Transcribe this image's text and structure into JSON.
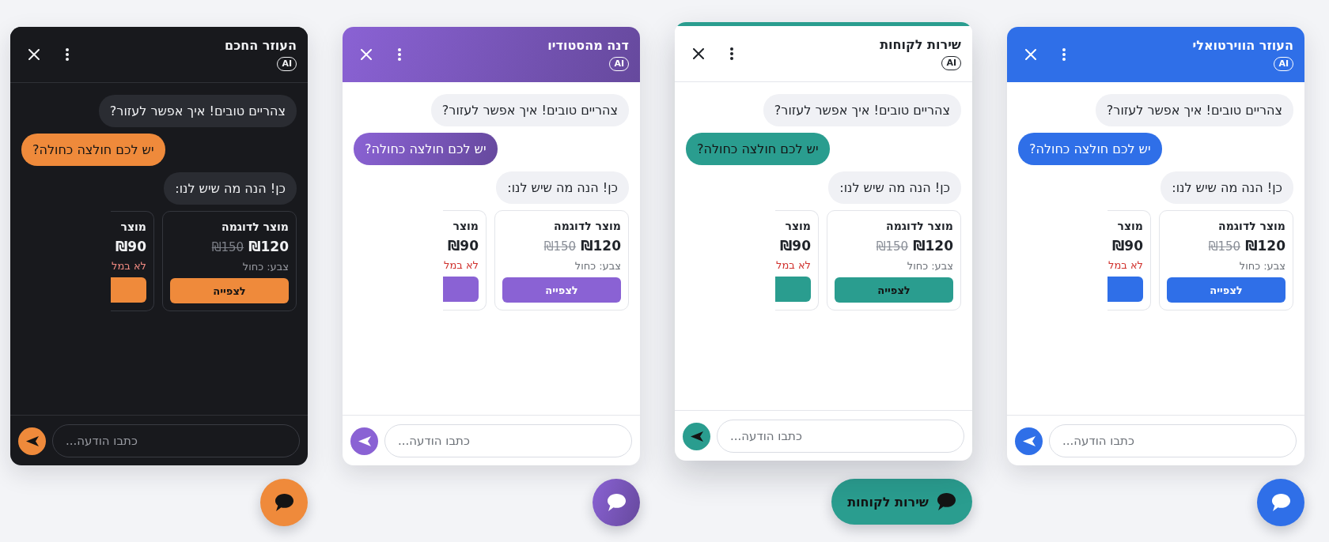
{
  "widgets": [
    {
      "dark": false,
      "color": "#2f6fe8",
      "raised": false,
      "header": {
        "kind": "solid",
        "title": "העוזר הווירטואלי",
        "badge": "AI"
      },
      "messages": [
        {
          "kind": "bot",
          "text": "צהריים טובים! איך אפשר לעזור?"
        },
        {
          "kind": "user",
          "text": "יש לכם חולצה כחולה?"
        },
        {
          "kind": "bot",
          "text": "כן! הנה מה שיש לנו:"
        }
      ],
      "products": [
        {
          "kind": "full",
          "title": "מוצר לדוגמה",
          "price": "₪120",
          "old_price": "₪150",
          "detail": "צבע: כחול",
          "button": "לצפייה"
        },
        {
          "kind": "partial",
          "title": "מוצר",
          "price": "₪90",
          "status": "לא במל"
        }
      ],
      "composer": {
        "placeholder": "כתבו הודעה..."
      },
      "launcher": {
        "kind": "icon"
      }
    },
    {
      "dark": false,
      "color": "#2a9d8f",
      "raised": true,
      "header": {
        "kind": "bar",
        "title": "שירות לקוחות",
        "badge": "AI"
      },
      "messages": [
        {
          "kind": "bot",
          "text": "צהריים טובים! איך אפשר לעזור?"
        },
        {
          "kind": "user",
          "text": "יש לכם חולצה כחולה?"
        },
        {
          "kind": "bot",
          "text": "כן! הנה מה שיש לנו:"
        }
      ],
      "products": [
        {
          "kind": "full",
          "title": "מוצר לדוגמה",
          "price": "₪120",
          "old_price": "₪150",
          "detail": "צבע: כחול",
          "button": "לצפייה"
        },
        {
          "kind": "partial",
          "title": "מוצר",
          "price": "₪90",
          "status": "לא במל"
        }
      ],
      "composer": {
        "placeholder": "כתבו הודעה..."
      },
      "launcher": {
        "kind": "pill",
        "label": "שירות לקוחות"
      }
    },
    {
      "dark": false,
      "color": "#8a62d4",
      "raised": false,
      "header": {
        "kind": "gradient",
        "title": "דנה מהסטודיו",
        "badge": "AI"
      },
      "messages": [
        {
          "kind": "bot",
          "text": "צהריים טובים! איך אפשר לעזור?"
        },
        {
          "kind": "user",
          "text": "יש לכם חולצה כחולה?"
        },
        {
          "kind": "bot",
          "text": "כן! הנה מה שיש לנו:"
        }
      ],
      "products": [
        {
          "kind": "full",
          "title": "מוצר לדוגמה",
          "price": "₪120",
          "old_price": "₪150",
          "detail": "צבע: כחול",
          "button": "לצפייה"
        },
        {
          "kind": "partial",
          "title": "מוצר",
          "price": "₪90",
          "status": "לא במל"
        }
      ],
      "composer": {
        "placeholder": "כתבו הודעה..."
      },
      "launcher": {
        "kind": "icon"
      }
    },
    {
      "dark": true,
      "color": "#ef8a3b",
      "raised": false,
      "header": {
        "kind": "plain",
        "title": "העוזר החכם",
        "badge": "AI"
      },
      "messages": [
        {
          "kind": "bot",
          "text": "צהריים טובים! איך אפשר לעזור?"
        },
        {
          "kind": "user",
          "text": "יש לכם חולצה כחולה?"
        },
        {
          "kind": "bot",
          "text": "כן! הנה מה שיש לנו:"
        }
      ],
      "products": [
        {
          "kind": "full",
          "title": "מוצר לדוגמה",
          "price": "₪120",
          "old_price": "₪150",
          "detail": "צבע: כחול",
          "button": "לצפייה"
        },
        {
          "kind": "partial",
          "title": "מוצר",
          "price": "₪90",
          "status": "לא במל"
        }
      ],
      "composer": {
        "placeholder": "כתבו הודעה..."
      },
      "launcher": {
        "kind": "icon"
      }
    }
  ]
}
